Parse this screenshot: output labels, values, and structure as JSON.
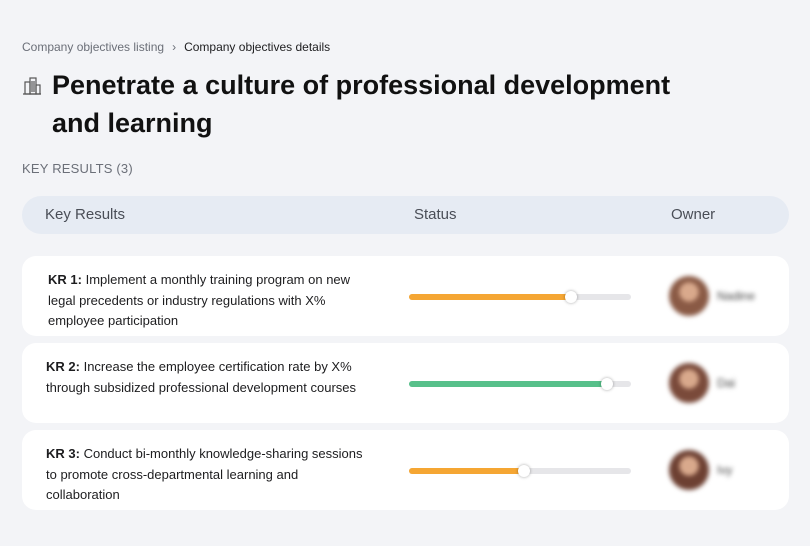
{
  "breadcrumb": {
    "parent": "Company objectives listing",
    "current": "Company objectives details"
  },
  "objective": {
    "icon": "building-icon",
    "title": "Penetrate a culture of professional development and learning"
  },
  "key_results_label": "KEY RESULTS (3)",
  "table": {
    "headers": {
      "key_results": "Key Results",
      "status": "Status",
      "owner": "Owner"
    },
    "rows": [
      {
        "id": "KR 1:",
        "text": "Implement a monthly training program on new legal precedents or industry regulations with X% employee participation",
        "progress": 0.73,
        "progress_color": "#f5a633",
        "owner": "Nadine",
        "avatar_color": "#8a5a45"
      },
      {
        "id": "KR 2:",
        "text": "Increase the employee certification rate by X% through subsidized professional development courses",
        "progress": 0.89,
        "progress_color": "#57c08a",
        "owner": "Dai",
        "avatar_color": "#7a4a3a"
      },
      {
        "id": "KR 3:",
        "text": "Conduct bi-monthly knowledge-sharing sessions to promote cross-departmental learning and collaboration",
        "progress": 0.52,
        "progress_color": "#f5a633",
        "owner": "Ivy",
        "avatar_color": "#6d4032"
      }
    ]
  }
}
